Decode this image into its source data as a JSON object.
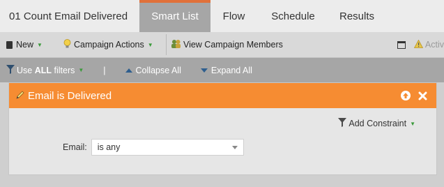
{
  "tabs": {
    "title": "01 Count Email Delivered",
    "items": [
      {
        "label": "Smart List",
        "active": true
      },
      {
        "label": "Flow"
      },
      {
        "label": "Schedule"
      },
      {
        "label": "Results"
      }
    ]
  },
  "toolbar": {
    "new_label": "New",
    "campaign_actions_label": "Campaign Actions",
    "view_members_label": "View Campaign Members",
    "activate_label": "Activ"
  },
  "filterbar": {
    "use_label_prefix": "Use ",
    "use_label_bold": "ALL",
    "use_label_suffix": " filters",
    "divider": "|",
    "collapse_label": "Collapse All",
    "expand_label": "Expand All"
  },
  "filter": {
    "title": "Email is Delivered",
    "add_constraint_label": "Add Constraint",
    "field_label": "Email:",
    "field_value": "is any"
  },
  "colors": {
    "accent": "#f68c32",
    "tab_active": "#a6a6a6",
    "tab_active_border": "#e0713a"
  }
}
